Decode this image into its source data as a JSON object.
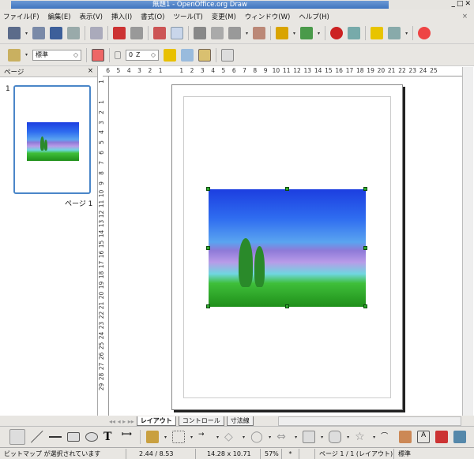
{
  "window": {
    "title": "無題1 - OpenOffice.org Draw",
    "controls": "_□✕"
  },
  "menu": [
    "ファイル(F)",
    "編集(E)",
    "表示(V)",
    "挿入(I)",
    "書式(O)",
    "ツール(T)",
    "変更(M)",
    "ウィンドウ(W)",
    "ヘルプ(H)"
  ],
  "menu_close": "×",
  "toolbar2": {
    "style": "標準",
    "line_width": "0 Ｚ"
  },
  "pages_panel": {
    "title": "ページ",
    "close": "×",
    "thumb_number": "1",
    "thumb_label": "ページ 1"
  },
  "ruler_h": [
    "6",
    "5",
    "4",
    "3",
    "2",
    "1",
    "",
    "1",
    "2",
    "3",
    "4",
    "5",
    "6",
    "7",
    "8",
    "9",
    "10",
    "11",
    "12",
    "13",
    "14",
    "15",
    "16",
    "17",
    "18",
    "19",
    "20",
    "21",
    "22",
    "23",
    "24",
    "25"
  ],
  "ruler_v": [
    "1",
    "",
    "1",
    "2",
    "3",
    "4",
    "5",
    "6",
    "7",
    "8",
    "9",
    "10",
    "11",
    "12",
    "13",
    "14",
    "15",
    "16",
    "17",
    "18",
    "19",
    "20",
    "21",
    "22",
    "23",
    "24",
    "25",
    "26",
    "27",
    "28",
    "29"
  ],
  "tabs": [
    "レイアウト",
    "コントロール",
    "寸法線"
  ],
  "status": {
    "message": "ビットマップ が選択されています",
    "position": "2.44 / 8.53",
    "size": "14.28 x 10.71",
    "zoom": "57%",
    "modified": "*",
    "page": "ページ 1 / 1 (レイアウト)",
    "style": "標準"
  },
  "colors": {
    "title_bar": "#3f74bf",
    "selection_handle": "#2fa82f",
    "thumb_border": "#4a86c8"
  }
}
